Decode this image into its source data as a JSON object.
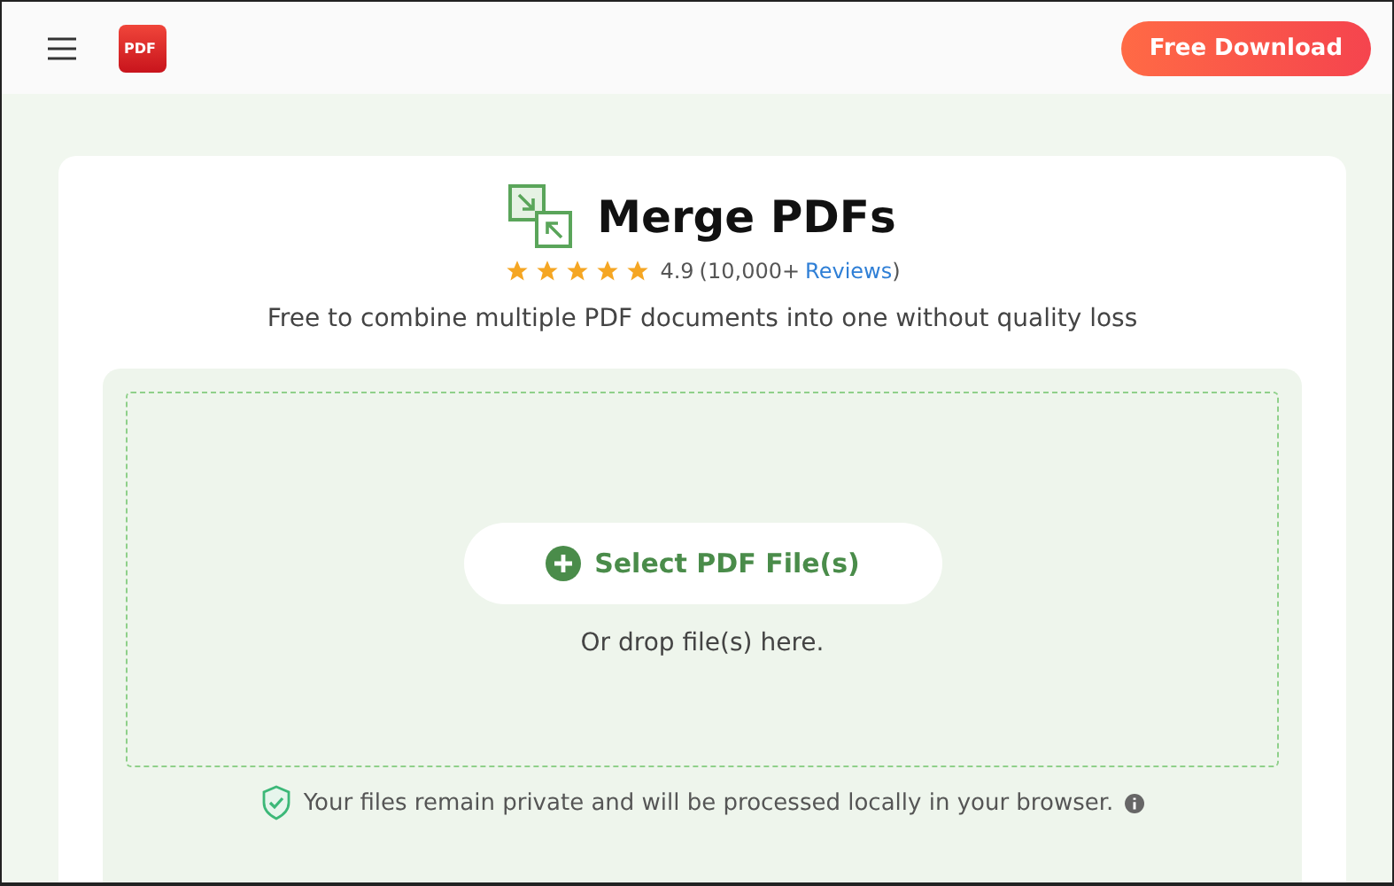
{
  "header": {
    "logo_text": "PDF",
    "download_button": "Free Download"
  },
  "tool": {
    "title": "Merge PDFs",
    "stars": 5,
    "rating": "4.9",
    "count": "(10,000+",
    "reviews_link": "Reviews",
    "count_close": ")",
    "subtitle": "Free to combine multiple PDF documents into one without quality loss"
  },
  "dropzone": {
    "select_button": "Select PDF File(s)",
    "hint": "Or drop file(s) here."
  },
  "privacy_note": "Your files remain private and will be processed locally in your browser."
}
